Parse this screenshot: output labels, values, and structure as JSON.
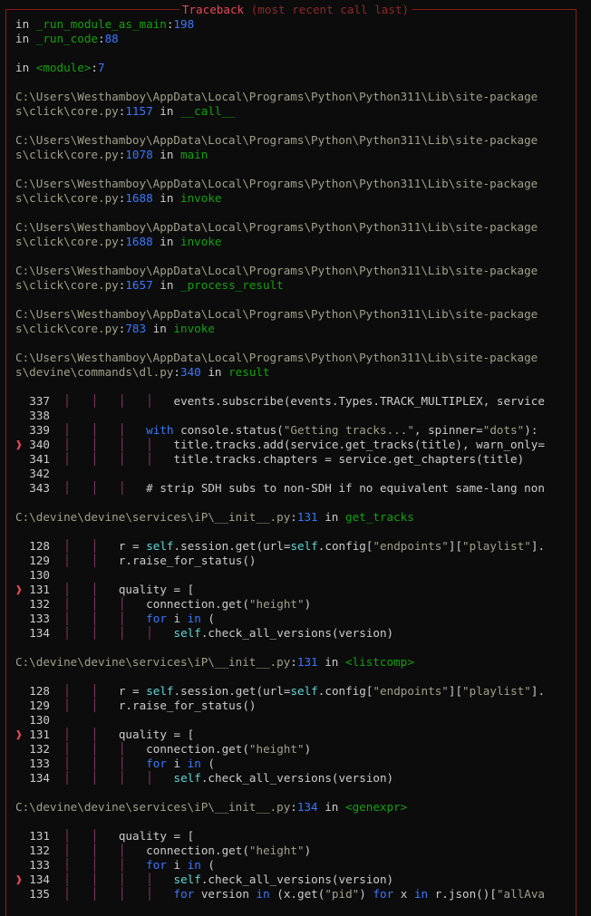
{
  "traceback": {
    "title": "Traceback",
    "subtitle": "(most recent call last)"
  },
  "frames_top": [
    {
      "prefix": "in ",
      "func": "_run_module_as_main",
      "sep": ":",
      "lineno": "198"
    },
    {
      "prefix": "in ",
      "func": "_run_code",
      "sep": ":",
      "lineno": "88"
    }
  ],
  "module_frame": {
    "prefix": "in ",
    "func": "<module>",
    "sep": ":",
    "lineno": "7"
  },
  "path_frames": [
    {
      "path1": "C:\\Users\\Westhamboy\\AppData\\Local\\Programs\\Python\\Python311\\Lib\\site-package",
      "path2": "s\\click\\core.py",
      "lineno": "1157",
      "func": "__call__"
    },
    {
      "path1": "C:\\Users\\Westhamboy\\AppData\\Local\\Programs\\Python\\Python311\\Lib\\site-package",
      "path2": "s\\click\\core.py",
      "lineno": "1078",
      "func": "main"
    },
    {
      "path1": "C:\\Users\\Westhamboy\\AppData\\Local\\Programs\\Python\\Python311\\Lib\\site-package",
      "path2": "s\\click\\core.py",
      "lineno": "1688",
      "func": "invoke"
    },
    {
      "path1": "C:\\Users\\Westhamboy\\AppData\\Local\\Programs\\Python\\Python311\\Lib\\site-package",
      "path2": "s\\click\\core.py",
      "lineno": "1688",
      "func": "invoke"
    },
    {
      "path1": "C:\\Users\\Westhamboy\\AppData\\Local\\Programs\\Python\\Python311\\Lib\\site-package",
      "path2": "s\\click\\core.py",
      "lineno": "1657",
      "func": "_process_result"
    },
    {
      "path1": "C:\\Users\\Westhamboy\\AppData\\Local\\Programs\\Python\\Python311\\Lib\\site-package",
      "path2": "s\\click\\core.py",
      "lineno": "783",
      "func": "invoke"
    },
    {
      "path1": "C:\\Users\\Westhamboy\\AppData\\Local\\Programs\\Python\\Python311\\Lib\\site-package",
      "path2": "s\\devine\\commands\\dl.py",
      "lineno": "340",
      "func": "result"
    }
  ],
  "code_blocks": [
    {
      "lines": [
        {
          "n": "337",
          "arrow": false,
          "guides": "│   │   │   │   ",
          "segs": [
            [
              "t",
              "events.subscribe(events.Types.TRACK_MULTIPLEX, service"
            ]
          ]
        },
        {
          "n": "338",
          "arrow": false,
          "guides": "",
          "segs": []
        },
        {
          "n": "339",
          "arrow": false,
          "guides": "│   │   │   ",
          "segs": [
            [
              "k",
              "with"
            ],
            [
              "t",
              " console.status("
            ],
            [
              "s",
              "\"Getting tracks...\""
            ],
            [
              "t",
              ", spinner="
            ],
            [
              "s",
              "\"dots\""
            ],
            [
              "t",
              "):"
            ]
          ]
        },
        {
          "n": "340",
          "arrow": true,
          "guides": "│   │   │   │   ",
          "segs": [
            [
              "t",
              "title.tracks.add(service.get_tracks(title), warn_only="
            ]
          ]
        },
        {
          "n": "341",
          "arrow": false,
          "guides": "│   │   │   │   ",
          "segs": [
            [
              "t",
              "title.tracks.chapters = service.get_chapters(title)"
            ]
          ]
        },
        {
          "n": "342",
          "arrow": false,
          "guides": "",
          "segs": []
        },
        {
          "n": "343",
          "arrow": false,
          "guides": "│   │   │   ",
          "segs": [
            [
              "t",
              "# strip SDH subs to non-SDH if no equivalent same-lang non"
            ]
          ]
        }
      ]
    },
    {
      "header": {
        "path": "C:\\devine\\devine\\services\\iP\\__init__.py",
        "lineno": "131",
        "func": "get_tracks"
      },
      "lines": [
        {
          "n": "128",
          "arrow": false,
          "guides": "│   │   ",
          "segs": [
            [
              "t",
              "r = "
            ],
            [
              "self",
              "self"
            ],
            [
              "t",
              ".session.get(url="
            ],
            [
              "self",
              "self"
            ],
            [
              "t",
              ".config["
            ],
            [
              "s",
              "\"endpoints\""
            ],
            [
              "t",
              "]["
            ],
            [
              "s",
              "\"playlist\""
            ],
            [
              "t",
              "]."
            ]
          ]
        },
        {
          "n": "129",
          "arrow": false,
          "guides": "│   │   ",
          "segs": [
            [
              "t",
              "r.raise_for_status()"
            ]
          ]
        },
        {
          "n": "130",
          "arrow": false,
          "guides": "",
          "segs": []
        },
        {
          "n": "131",
          "arrow": true,
          "guides": "│   │   ",
          "segs": [
            [
              "t",
              "quality = ["
            ]
          ]
        },
        {
          "n": "132",
          "arrow": false,
          "guides": "│   │   │   ",
          "segs": [
            [
              "t",
              "connection.get("
            ],
            [
              "s",
              "\"height\""
            ],
            [
              "t",
              ")"
            ]
          ]
        },
        {
          "n": "133",
          "arrow": false,
          "guides": "│   │   │   ",
          "segs": [
            [
              "k",
              "for"
            ],
            [
              "t",
              " i "
            ],
            [
              "k",
              "in"
            ],
            [
              "t",
              " ("
            ]
          ]
        },
        {
          "n": "134",
          "arrow": false,
          "guides": "│   │   │   │   ",
          "segs": [
            [
              "self",
              "self"
            ],
            [
              "t",
              ".check_all_versions(version)"
            ]
          ]
        }
      ]
    },
    {
      "header": {
        "path": "C:\\devine\\devine\\services\\iP\\__init__.py",
        "lineno": "131",
        "func": "<listcomp>"
      },
      "lines": [
        {
          "n": "128",
          "arrow": false,
          "guides": "│   │   ",
          "segs": [
            [
              "t",
              "r = "
            ],
            [
              "self",
              "self"
            ],
            [
              "t",
              ".session.get(url="
            ],
            [
              "self",
              "self"
            ],
            [
              "t",
              ".config["
            ],
            [
              "s",
              "\"endpoints\""
            ],
            [
              "t",
              "]["
            ],
            [
              "s",
              "\"playlist\""
            ],
            [
              "t",
              "]."
            ]
          ]
        },
        {
          "n": "129",
          "arrow": false,
          "guides": "│   │   ",
          "segs": [
            [
              "t",
              "r.raise_for_status()"
            ]
          ]
        },
        {
          "n": "130",
          "arrow": false,
          "guides": "",
          "segs": []
        },
        {
          "n": "131",
          "arrow": true,
          "guides": "│   │   ",
          "segs": [
            [
              "t",
              "quality = ["
            ]
          ]
        },
        {
          "n": "132",
          "arrow": false,
          "guides": "│   │   │   ",
          "segs": [
            [
              "t",
              "connection.get("
            ],
            [
              "s",
              "\"height\""
            ],
            [
              "t",
              ")"
            ]
          ]
        },
        {
          "n": "133",
          "arrow": false,
          "guides": "│   │   │   ",
          "segs": [
            [
              "k",
              "for"
            ],
            [
              "t",
              " i "
            ],
            [
              "k",
              "in"
            ],
            [
              "t",
              " ("
            ]
          ]
        },
        {
          "n": "134",
          "arrow": false,
          "guides": "│   │   │   │   ",
          "segs": [
            [
              "self",
              "self"
            ],
            [
              "t",
              ".check_all_versions(version)"
            ]
          ]
        }
      ]
    },
    {
      "header": {
        "path": "C:\\devine\\devine\\services\\iP\\__init__.py",
        "lineno": "134",
        "func": "<genexpr>"
      },
      "lines": [
        {
          "n": "131",
          "arrow": false,
          "guides": "│   │   ",
          "segs": [
            [
              "t",
              "quality = ["
            ]
          ]
        },
        {
          "n": "132",
          "arrow": false,
          "guides": "│   │   │   ",
          "segs": [
            [
              "t",
              "connection.get("
            ],
            [
              "s",
              "\"height\""
            ],
            [
              "t",
              ")"
            ]
          ]
        },
        {
          "n": "133",
          "arrow": false,
          "guides": "│   │   │   ",
          "segs": [
            [
              "k",
              "for"
            ],
            [
              "t",
              " i "
            ],
            [
              "k",
              "in"
            ],
            [
              "t",
              " ("
            ]
          ]
        },
        {
          "n": "134",
          "arrow": true,
          "guides": "│   │   │   │   ",
          "segs": [
            [
              "self",
              "self"
            ],
            [
              "t",
              ".check_all_versions(version)"
            ]
          ]
        },
        {
          "n": "135",
          "arrow": false,
          "guides": "│   │   │   │   ",
          "segs": [
            [
              "k",
              "for"
            ],
            [
              "t",
              " version "
            ],
            [
              "k",
              "in"
            ],
            [
              "t",
              " (x.get("
            ],
            [
              "s",
              "\"pid\""
            ],
            [
              "t",
              ") "
            ],
            [
              "k",
              "for"
            ],
            [
              "t",
              " x "
            ],
            [
              "k",
              "in"
            ],
            [
              "t",
              " r.json()["
            ],
            [
              "s",
              "\"allAva"
            ]
          ]
        }
      ]
    }
  ],
  "arrow_glyph": "❱",
  "in_word": " in ",
  "colors": {
    "background": "#0c0c0c",
    "border": "#8b1a1a",
    "function": "#13a10e",
    "lineno": "#3b78ff",
    "path": "#a0a08a",
    "keyword": "#3b78ff",
    "self": "#61d6d6",
    "guide": "#8a3a6a"
  }
}
